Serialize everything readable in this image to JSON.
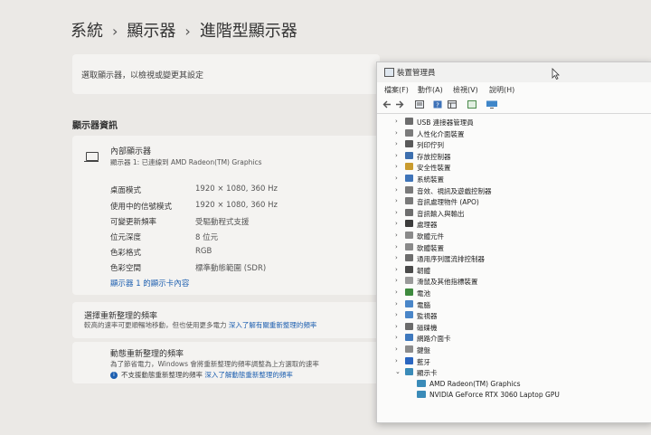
{
  "breadcrumb": {
    "items": [
      "系統",
      "顯示器",
      "進階型顯示器"
    ],
    "separator": "›"
  },
  "settings": {
    "subtitle": "選取顯示器，以檢視或變更其設定",
    "section_title": "顯示器資訊",
    "display_name": "內部顯示器",
    "display_sub": "顯示器 1: 已連線到 AMD Radeon(TM) Graphics",
    "info": [
      {
        "label": "桌面模式",
        "value": "1920 × 1080, 360 Hz"
      },
      {
        "label": "使用中的信號模式",
        "value": "1920 × 1080, 360 Hz"
      },
      {
        "label": "可變更新頻率",
        "value": "受驅動程式支援"
      },
      {
        "label": "位元深度",
        "value": "8 位元"
      },
      {
        "label": "色彩格式",
        "value": "RGB"
      },
      {
        "label": "色彩空間",
        "value": "標準動態範圍 (SDR)"
      }
    ],
    "adapter_link": "顯示器 1 的顯示卡內容",
    "refresh": {
      "title": "選擇重新整理的頻率",
      "desc": "較高的速率可更順暢地移動，但也使用更多電力",
      "link": "深入了解有關重新整理的頻率"
    },
    "dynamic": {
      "title": "動態重新整理的頻率",
      "desc": "為了節省電力，Windows 會將重新整理的頻率調整為上方選取的速率",
      "note": "不支援動態重新整理的頻率",
      "link": "深入了解動態重新整理的頻率",
      "info_glyph": "i"
    }
  },
  "device_manager": {
    "title": "裝置管理員",
    "menu": [
      "檔案(F)",
      "動作(A)",
      "檢視(V)",
      "說明(H)"
    ],
    "nodes": [
      {
        "label": "USB 連接器管理員",
        "chev": "›",
        "icon": "usb-icon",
        "color": "#6d6d6d"
      },
      {
        "label": "人性化介面裝置",
        "chev": "›",
        "icon": "hid-icon",
        "color": "#7b7b7b"
      },
      {
        "label": "列印佇列",
        "chev": "›",
        "icon": "printer-icon",
        "color": "#5a5a5a"
      },
      {
        "label": "存放控制器",
        "chev": "›",
        "icon": "storage-controller-icon",
        "color": "#3d6fae"
      },
      {
        "label": "安全性裝置",
        "chev": "›",
        "icon": "security-icon",
        "color": "#c99b2e"
      },
      {
        "label": "系統裝置",
        "chev": "›",
        "icon": "system-icon",
        "color": "#3f74b8"
      },
      {
        "label": "音效、視訊及遊戲控制器",
        "chev": "›",
        "icon": "sound-icon",
        "color": "#7a7a7a"
      },
      {
        "label": "音訊處理物件 (APO)",
        "chev": "›",
        "icon": "audio-icon",
        "color": "#7a7a7a"
      },
      {
        "label": "音訊輸入與輸出",
        "chev": "›",
        "icon": "speaker-icon",
        "color": "#6e6e6e"
      },
      {
        "label": "處理器",
        "chev": "›",
        "icon": "processor-icon",
        "color": "#3c3c3c"
      },
      {
        "label": "軟體元件",
        "chev": "›",
        "icon": "software-icon",
        "color": "#8a8a8a"
      },
      {
        "label": "軟體裝置",
        "chev": "›",
        "icon": "software-device-icon",
        "color": "#8a8a8a"
      },
      {
        "label": "通用序列匯流排控制器",
        "chev": "›",
        "icon": "usb-controller-icon",
        "color": "#6d6d6d"
      },
      {
        "label": "韌體",
        "chev": "›",
        "icon": "firmware-icon",
        "color": "#4a4a4a"
      },
      {
        "label": "滑鼠及其他指標裝置",
        "chev": "›",
        "icon": "mouse-icon",
        "color": "#9a9a9a"
      },
      {
        "label": "電池",
        "chev": "›",
        "icon": "battery-icon",
        "color": "#3e8a3e"
      },
      {
        "label": "電腦",
        "chev": "›",
        "icon": "computer-icon",
        "color": "#4a86c8"
      },
      {
        "label": "監視器",
        "chev": "›",
        "icon": "monitor-icon",
        "color": "#4a86c8"
      },
      {
        "label": "磁碟機",
        "chev": "›",
        "icon": "disk-icon",
        "color": "#6b6b6b"
      },
      {
        "label": "網路介面卡",
        "chev": "›",
        "icon": "network-icon",
        "color": "#3f79bd"
      },
      {
        "label": "鍵盤",
        "chev": "›",
        "icon": "keyboard-icon",
        "color": "#8c8c8c"
      },
      {
        "label": "藍牙",
        "chev": "›",
        "icon": "bluetooth-icon",
        "color": "#2a66c0"
      },
      {
        "label": "顯示卡",
        "chev": "⌄",
        "icon": "display-adapter-icon",
        "color": "#3a8bb8"
      }
    ],
    "children": [
      {
        "label": "AMD Radeon(TM) Graphics",
        "icon": "display-adapter-icon",
        "color": "#3a8bb8"
      },
      {
        "label": "NVIDIA GeForce RTX 3060 Laptop GPU",
        "icon": "display-adapter-icon",
        "color": "#3a8bb8"
      }
    ]
  }
}
